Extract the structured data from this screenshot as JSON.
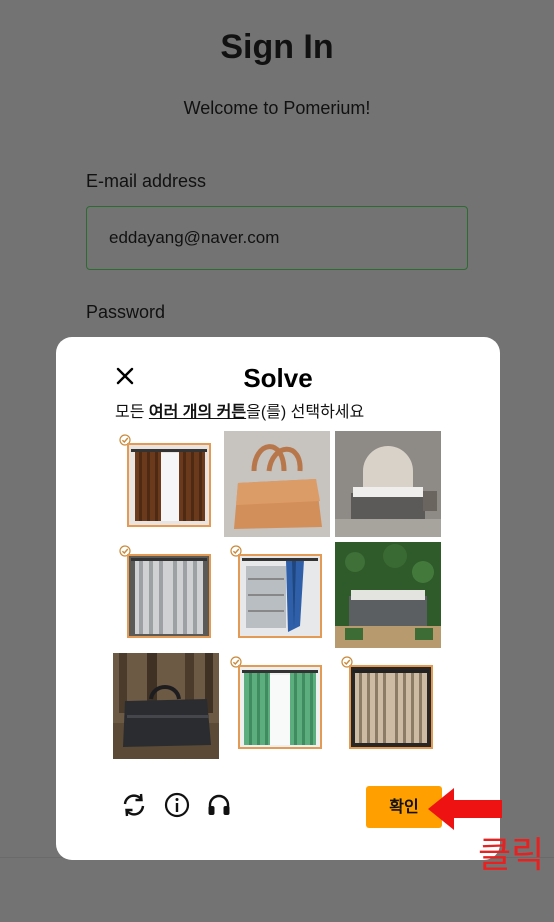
{
  "page": {
    "title": "Sign In",
    "subtitle": "Welcome to Pomerium!",
    "email_label": "E-mail address",
    "email_value": "eddayang@naver.com",
    "password_label": "Password"
  },
  "captcha": {
    "title": "Solve",
    "instruction_prefix": "모든 ",
    "instruction_emphasis": "여러 개의 커튼",
    "instruction_suffix": "을(를) 선택하세요",
    "tiles": [
      {
        "subject": "brown curtains",
        "selected": true
      },
      {
        "subject": "tan woven tote bag",
        "selected": false
      },
      {
        "subject": "bedroom with bed",
        "selected": false
      },
      {
        "subject": "grey sheer curtains",
        "selected": true
      },
      {
        "subject": "blue curtain by window",
        "selected": true
      },
      {
        "subject": "bedroom with green wall",
        "selected": false
      },
      {
        "subject": "black duffel bag in forest",
        "selected": false
      },
      {
        "subject": "green curtains",
        "selected": true
      },
      {
        "subject": "beige patterned curtains",
        "selected": true
      }
    ],
    "icons": [
      "refresh-icon",
      "info-icon",
      "headphones-icon"
    ],
    "confirm_label": "확인"
  },
  "annotation": {
    "text": "클릭",
    "color": "#e82020"
  },
  "colors": {
    "overlay": "#737373",
    "accent": "#ffa000",
    "selected_border": "#e39a55",
    "input_border": "#2e6b33"
  }
}
